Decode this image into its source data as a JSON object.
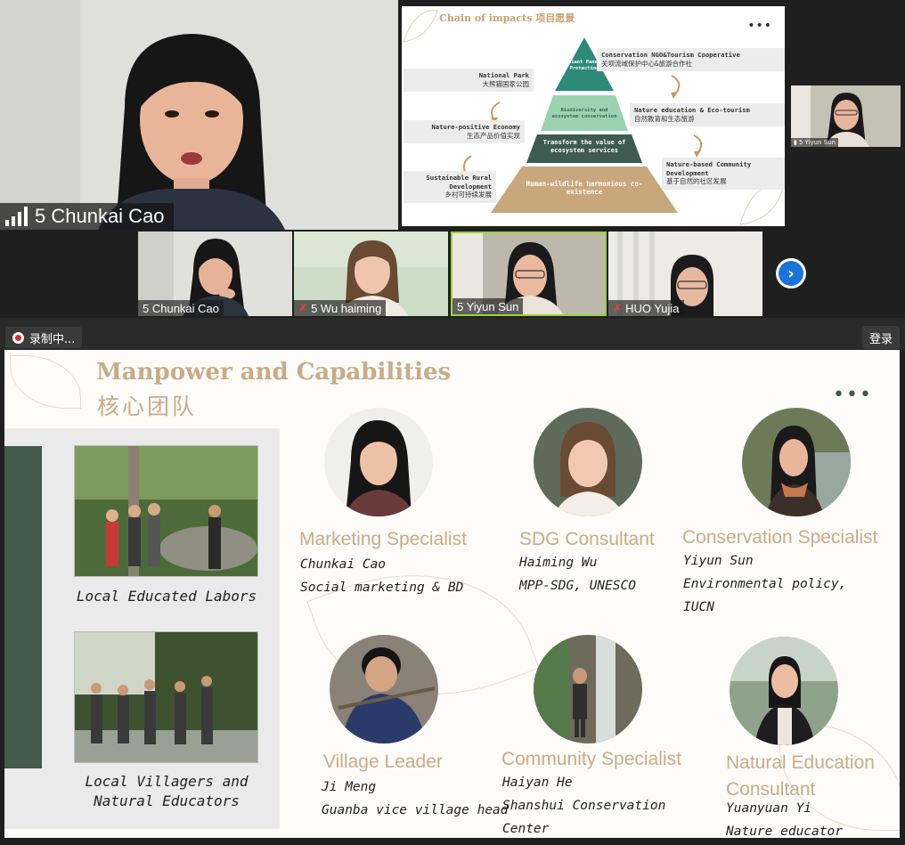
{
  "main_tile": {
    "name": "5 Chunkai Cao"
  },
  "shared_top": {
    "title": "Chain of impacts  项目愿景",
    "more": "•••",
    "labels": [
      {
        "en": "Conservation NGO&Tourism Cooperative",
        "cn": "关坝流域保护中心&旅游合作社"
      },
      {
        "en": "National Park",
        "cn": "大熊猫国家公园"
      },
      {
        "en": "Nature education & Eco-tourism",
        "cn": "自然教育和生态旅游"
      },
      {
        "en": "Nature-positive Economy",
        "cn": "生态产品价值实现"
      },
      {
        "en": "Nature-based Community Development",
        "cn": "基于自然的社区发展"
      },
      {
        "en": "Sustainable Rural Development",
        "cn": "乡村可持续发展"
      }
    ],
    "pyramid": [
      "Giant Panda Protection",
      "Biodiversity and ecosystem conservation",
      "Transform the value of ecosystem services",
      "Human-wildlife harmonious co-existence"
    ]
  },
  "small_tile": {
    "name": "5 Yiyun Sun"
  },
  "strip": [
    {
      "name": "5 Chunkai Cao",
      "muted": false
    },
    {
      "name": "5 Wu haiming",
      "muted": true
    },
    {
      "name": "5 Yiyun Sun",
      "muted": false
    },
    {
      "name": "HUO Yujia",
      "muted": true
    }
  ],
  "next_label": "›",
  "record_label": "录制中...",
  "login_label": "登录",
  "slide": {
    "title": "Manpower and Capabilities",
    "subtitle": "核心团队",
    "dots": "•••",
    "photo_captions": [
      "Local Educated Labors",
      "Local Villagers and Natural Educators"
    ],
    "team": [
      {
        "role": "Marketing Specialist",
        "name": "Chunkai Cao",
        "lines": [
          "Social marketing & BD"
        ]
      },
      {
        "role": "SDG Consultant",
        "name": "Haiming Wu",
        "lines": [
          "MPP-SDG, UNESCO"
        ]
      },
      {
        "role": "Conservation Specialist",
        "name": "Yiyun Sun",
        "lines": [
          "Environmental policy,",
          "IUCN"
        ]
      },
      {
        "role": "Village Leader",
        "name": "Ji Meng",
        "lines": [
          "Guanba vice village head"
        ]
      },
      {
        "role": "Community Specialist",
        "name": "Haiyan He",
        "lines": [
          "Shanshui Conservation",
          "Center"
        ]
      },
      {
        "role": "Natural Education",
        "role2": "Consultant",
        "name": "Yuanyuan Yi",
        "lines": [
          "Nature educator"
        ]
      }
    ]
  },
  "colors": {
    "gold": "#c9ab88",
    "green": "#435a4d",
    "zoom_blue": "#1a73d9"
  }
}
